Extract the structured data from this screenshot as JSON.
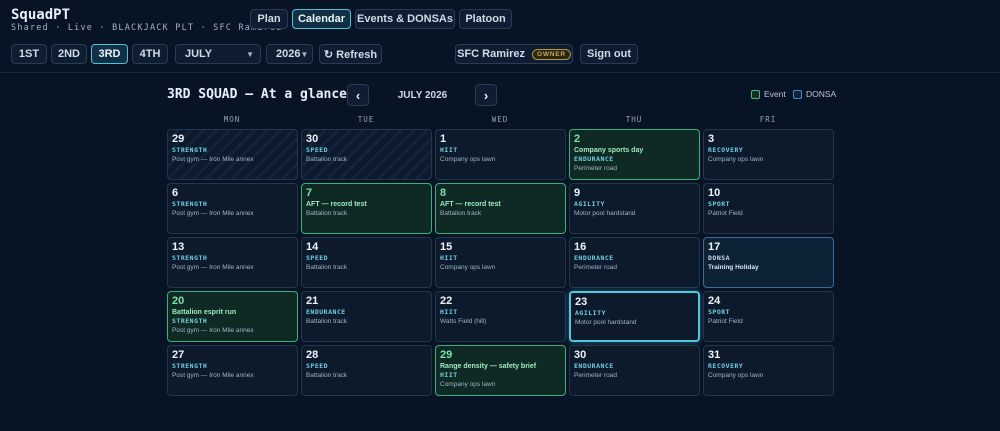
{
  "app": {
    "title": "SquadPT",
    "subtitle": "Shared · Live · BLACKJACK PLT · SFC Ramirez"
  },
  "nav_tabs": [
    {
      "label": "Plan",
      "active": false
    },
    {
      "label": "Calendar",
      "active": true
    },
    {
      "label": "Events & DONSAs",
      "active": false
    },
    {
      "label": "Platoon",
      "active": false
    }
  ],
  "squads": [
    {
      "label": "1ST",
      "active": false
    },
    {
      "label": "2ND",
      "active": false
    },
    {
      "label": "3RD",
      "active": true
    },
    {
      "label": "4TH",
      "active": false
    }
  ],
  "controls": {
    "month": "JULY",
    "year": "2026",
    "refresh": "↻ Refresh"
  },
  "user": {
    "name": "SFC Ramirez",
    "role": "OWNER",
    "signout": "Sign out"
  },
  "calendar": {
    "title": "3RD SQUAD — At a glance",
    "month_label": "JULY 2026",
    "prev": "‹",
    "next": "›",
    "legend_event": "Event",
    "legend_donsa": "DONSA",
    "weekdays": [
      "MON",
      "TUE",
      "WED",
      "THU",
      "FRI"
    ],
    "weeks": [
      [
        {
          "day": "29",
          "cat": "STRENGTH",
          "loc": "Post gym — Iron Mile annex",
          "kind": "prev"
        },
        {
          "day": "30",
          "cat": "SPEED",
          "loc": "Battalion track",
          "kind": "prev"
        },
        {
          "day": "1",
          "cat": "HIIT",
          "loc": "Company ops lawn",
          "kind": ""
        },
        {
          "day": "2",
          "event": "Company sports day",
          "cat": "ENDURANCE",
          "loc": "Perimeter road",
          "kind": "event"
        },
        {
          "day": "3",
          "cat": "RECOVERY",
          "loc": "Company ops lawn",
          "kind": ""
        }
      ],
      [
        {
          "day": "6",
          "cat": "STRENGTH",
          "loc": "Post gym — Iron Mile annex",
          "kind": ""
        },
        {
          "day": "7",
          "event": "AFT — record test",
          "loc": "Battalion track",
          "kind": "event"
        },
        {
          "day": "8",
          "event": "AFT — record test",
          "loc": "Battalion track",
          "kind": "event"
        },
        {
          "day": "9",
          "cat": "AGILITY",
          "loc": "Motor pool hardstand",
          "kind": ""
        },
        {
          "day": "10",
          "cat": "SPORT",
          "loc": "Patriot Field",
          "kind": ""
        }
      ],
      [
        {
          "day": "13",
          "cat": "STRENGTH",
          "loc": "Post gym — Iron Mile annex",
          "kind": ""
        },
        {
          "day": "14",
          "cat": "SPEED",
          "loc": "Battalion track",
          "kind": ""
        },
        {
          "day": "15",
          "cat": "HIIT",
          "loc": "Company ops lawn",
          "kind": ""
        },
        {
          "day": "16",
          "cat": "ENDURANCE",
          "loc": "Perimeter road",
          "kind": ""
        },
        {
          "day": "17",
          "cat": "DONSA",
          "loc": "Training Holiday",
          "kind": "donsa"
        }
      ],
      [
        {
          "day": "20",
          "event": "Battalion esprit run",
          "cat": "STRENGTH",
          "loc": "Post gym — Iron Mile annex",
          "kind": "event"
        },
        {
          "day": "21",
          "cat": "ENDURANCE",
          "loc": "Battalion track",
          "kind": ""
        },
        {
          "day": "22",
          "cat": "HIIT",
          "loc": "Watts Field (hill)",
          "kind": ""
        },
        {
          "day": "23",
          "cat": "AGILITY",
          "loc": "Motor pool hardstand",
          "kind": "today"
        },
        {
          "day": "24",
          "cat": "SPORT",
          "loc": "Patriot Field",
          "kind": ""
        }
      ],
      [
        {
          "day": "27",
          "cat": "STRENGTH",
          "loc": "Post gym — Iron Mile annex",
          "kind": ""
        },
        {
          "day": "28",
          "cat": "SPEED",
          "loc": "Battalion track",
          "kind": ""
        },
        {
          "day": "29",
          "event": "Range density — safety brief",
          "cat": "HIIT",
          "loc": "Company ops lawn",
          "kind": "event"
        },
        {
          "day": "30",
          "cat": "ENDURANCE",
          "loc": "Perimeter road",
          "kind": ""
        },
        {
          "day": "31",
          "cat": "RECOVERY",
          "loc": "Company ops lawn",
          "kind": ""
        }
      ]
    ]
  }
}
